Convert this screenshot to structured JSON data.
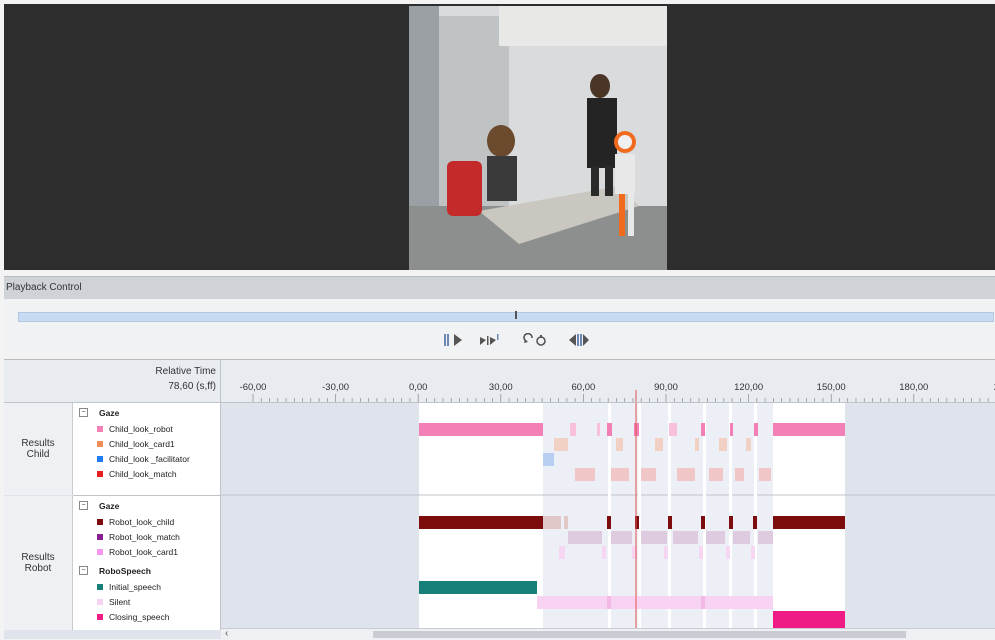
{
  "video": {
    "panel": "video-panel"
  },
  "playback": {
    "title": "Playback Control",
    "position_fraction": 0.511
  },
  "timeline": {
    "header_label": "Relative Time",
    "current_time": "78,60 (s,ff)",
    "ticks": [
      "-60,00",
      "-30,00",
      "0,00",
      "30,00",
      "60,00",
      "90,00",
      "120,00",
      "150,00",
      "180,00",
      "2"
    ],
    "groups": [
      {
        "label": "Results\nChild",
        "tiers": [
          {
            "title": "Gaze",
            "items": [
              {
                "label": "Child_look_robot",
                "color": "#f27fb6"
              },
              {
                "label": "Child_look_card1",
                "color": "#f28c56"
              },
              {
                "label": "Child_look _facilitator",
                "color": "#1e7ef0"
              },
              {
                "label": "Child_look_match",
                "color": "#e81f1f"
              }
            ]
          }
        ]
      },
      {
        "label": "Results\nRobot",
        "tiers": [
          {
            "title": "Gaze",
            "items": [
              {
                "label": "Robot_look_child",
                "color": "#7d0d0d"
              },
              {
                "label": "Robot_look_match",
                "color": "#8a1d8f"
              },
              {
                "label": "Robot_look_card1",
                "color": "#f596f0"
              }
            ]
          },
          {
            "title": "RoboSpeech",
            "items": [
              {
                "label": "Initial_speech",
                "color": "#157f78"
              },
              {
                "label": "Silent",
                "color": "#f8d3f1"
              },
              {
                "label": "Closing_speech",
                "color": "#f01c86"
              }
            ]
          }
        ]
      }
    ],
    "scroll_left_arrow": "‹"
  },
  "icons": {
    "pause-play": "pause-play-icon",
    "step-frames": "step-frames-icon",
    "loop": "loop-icon",
    "segment": "segment-icon",
    "collapse": "collapse-icon"
  }
}
